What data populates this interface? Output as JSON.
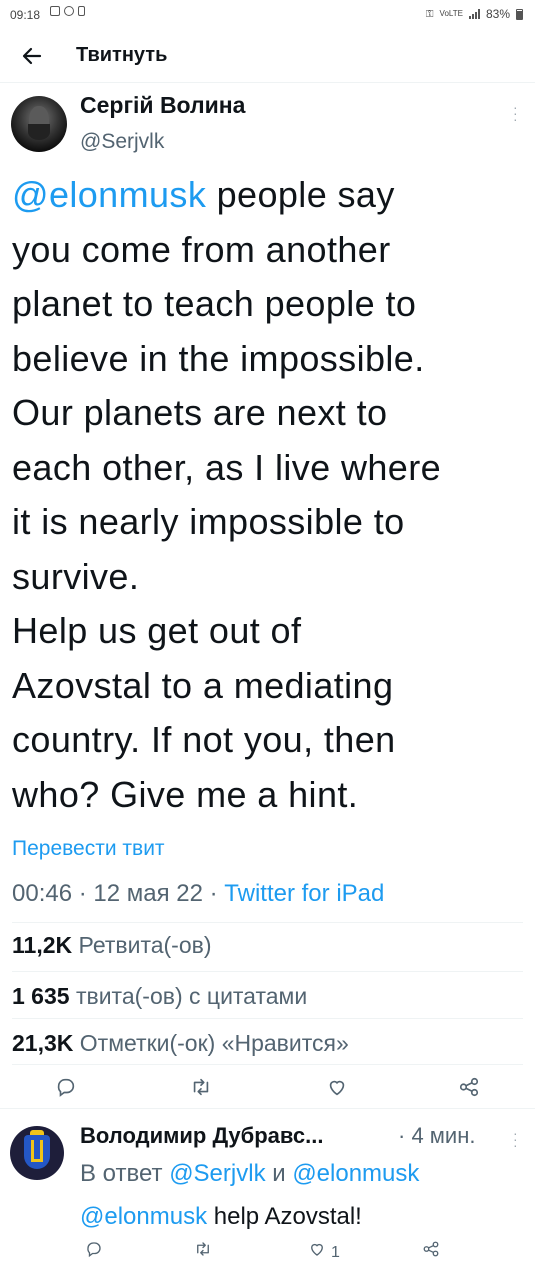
{
  "status_bar": {
    "time": "09:18",
    "battery": "83%"
  },
  "header": {
    "back_icon": "arrow-left-icon",
    "title": "Твитнуть"
  },
  "tweet": {
    "author_name": "Сергій Волина",
    "author_handle": "@Serjvlk",
    "text_lines": [
      {
        "mention": "@elonmusk",
        "text": " people say"
      },
      {
        "mention": "",
        "text": "you come from another"
      },
      {
        "mention": "",
        "text": "planet to teach people to"
      },
      {
        "mention": "",
        "text": "believe in the impossible."
      },
      {
        "mention": "",
        "text": "Our planets are next to"
      },
      {
        "mention": "",
        "text": "each other, as I live where"
      },
      {
        "mention": "",
        "text": "it is nearly impossible to"
      },
      {
        "mention": "",
        "text": "survive."
      },
      {
        "mention": "",
        "text": "Help us get out of"
      },
      {
        "mention": "",
        "text": "Azovstal to a mediating"
      },
      {
        "mention": "",
        "text": "country. If not you, then"
      },
      {
        "mention": "",
        "text": "who? Give me a hint."
      }
    ],
    "translate_label": "Перевести твит",
    "time": "00:46",
    "date": "12 мая 22",
    "separator": " · ",
    "source": "Twitter for iPad",
    "stats": {
      "retweets_count": "11,2K",
      "retweets_label": "Ретвита(-ов)",
      "quotes_count": "1 635",
      "quotes_label": "твита(-ов) с цитатами",
      "likes_count": "21,3K",
      "likes_label": "Отметки(-ок) «Нравится»"
    }
  },
  "reply": {
    "author_name": "Володимир Дубравс...",
    "time": "· 4 мин.",
    "replying_prefix": "В ответ ",
    "replying_to_1": "@Serjvlk",
    "replying_joiner": " и ",
    "replying_to_2": "@elonmusk",
    "text_mention": "@elonmusk",
    "text": " help Azovstal!",
    "like_count": "1"
  },
  "colors": {
    "accent": "#1d9bf0",
    "secondary_text": "#536471",
    "primary_text": "#0f1419"
  }
}
